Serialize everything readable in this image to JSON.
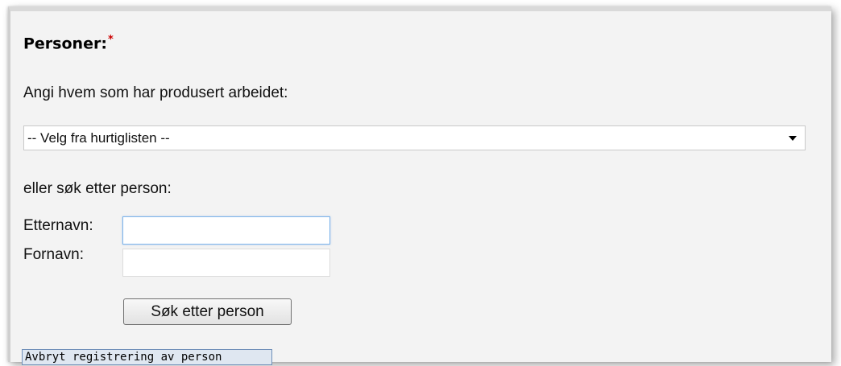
{
  "form": {
    "title": "Personer:",
    "required_marker": "*",
    "instruction": "Angi hvem som har produsert arbeidet:",
    "quicklist_select": {
      "selected": "-- Velg fra hurtiglisten --",
      "icon": "chevron-down-icon"
    },
    "search_prompt": "eller søk etter person:",
    "last_name": {
      "label": "Etternavn:",
      "value": ""
    },
    "first_name": {
      "label": "Fornavn:",
      "value": ""
    },
    "search_button": "Søk etter person",
    "cancel_button": "Avbryt registrering av person"
  }
}
